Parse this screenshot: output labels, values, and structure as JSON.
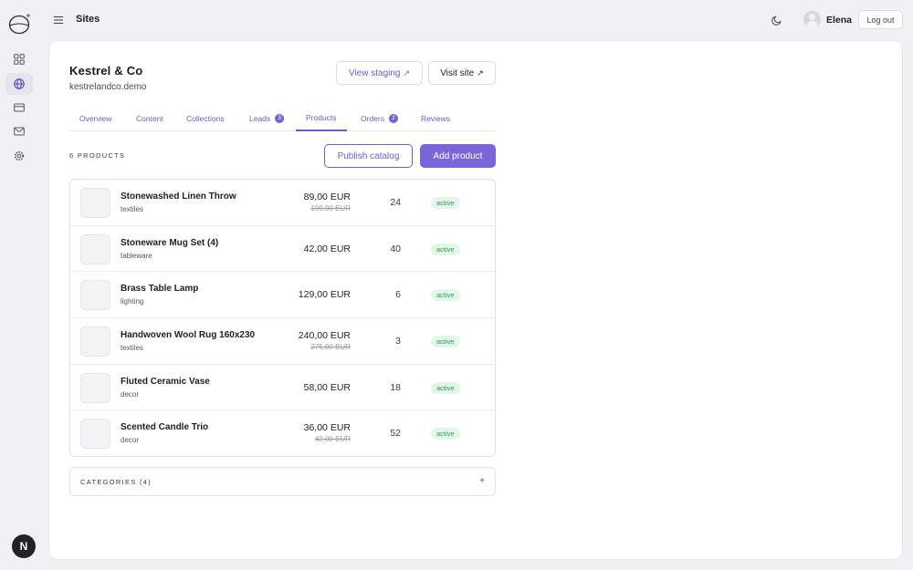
{
  "header": {
    "title": "Sites",
    "user_name": "Elena",
    "logout_label": "Log out"
  },
  "rail": {
    "items": [
      {
        "icon": "dashboard-grid-icon",
        "active": false
      },
      {
        "icon": "globe-icon",
        "active": true
      },
      {
        "icon": "credit-card-icon",
        "active": false
      },
      {
        "icon": "mail-icon",
        "active": false
      },
      {
        "icon": "gear-icon",
        "active": false
      }
    ],
    "bottom_badge": "N"
  },
  "site": {
    "name": "Kestrel & Co",
    "domain": "kestrelandco.demo",
    "view_staging_label": "View staging",
    "visit_site_label": "Visit site",
    "external_glyph": "↗"
  },
  "tabs": [
    {
      "label": "Overview",
      "badge": null,
      "active": false
    },
    {
      "label": "Content",
      "badge": null,
      "active": false
    },
    {
      "label": "Collections",
      "badge": null,
      "active": false
    },
    {
      "label": "Leads",
      "badge": "3",
      "active": false
    },
    {
      "label": "Products",
      "badge": null,
      "active": true
    },
    {
      "label": "Orders",
      "badge": "2",
      "active": false
    },
    {
      "label": "Reviews",
      "badge": null,
      "active": false
    }
  ],
  "products": {
    "count_label": "6 PRODUCTS",
    "publish_label": "Publish catalog",
    "add_label": "Add product",
    "items": [
      {
        "name": "Stonewashed Linen Throw",
        "category": "textiles",
        "price": "89,00 EUR",
        "old_price": "109,00 EUR",
        "stock": "24",
        "status": "active"
      },
      {
        "name": "Stoneware Mug Set (4)",
        "category": "tableware",
        "price": "42,00 EUR",
        "old_price": "",
        "stock": "40",
        "status": "active"
      },
      {
        "name": "Brass Table Lamp",
        "category": "lighting",
        "price": "129,00 EUR",
        "old_price": "",
        "stock": "6",
        "status": "active"
      },
      {
        "name": "Handwoven Wool Rug 160x230",
        "category": "textiles",
        "price": "240,00 EUR",
        "old_price": "275,00 EUR",
        "stock": "3",
        "status": "active"
      },
      {
        "name": "Fluted Ceramic Vase",
        "category": "decor",
        "price": "58,00 EUR",
        "old_price": "",
        "stock": "18",
        "status": "active"
      },
      {
        "name": "Scented Candle Trio",
        "category": "decor",
        "price": "36,00 EUR",
        "old_price": "42,00 EUR",
        "stock": "52",
        "status": "active"
      }
    ]
  },
  "categories": {
    "label": "CATEGORIES (4)",
    "toggle": "+"
  },
  "colors": {
    "accent": "#6d5bd0",
    "accent_fill": "#7a66d8",
    "status_bg": "#e3f6e9",
    "status_text": "#2e9a55"
  }
}
